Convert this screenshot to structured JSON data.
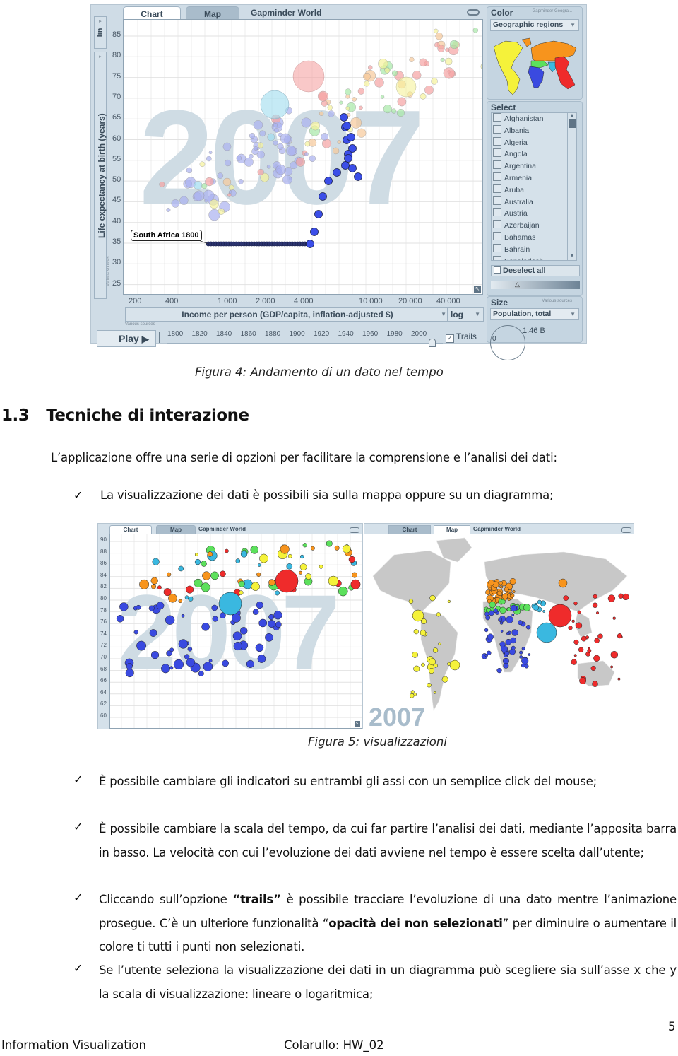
{
  "figure4": {
    "tabs": [
      {
        "label": "Chart",
        "active": true
      },
      {
        "label": "Map",
        "active": false
      }
    ],
    "title": "Gapminder World",
    "link_icon": "link-icon",
    "y_scale_label": "lin",
    "y_axis_label": "Life expectancy at birth (years)",
    "y_ticks": [
      "85",
      "80",
      "75",
      "70",
      "65",
      "60",
      "55",
      "50",
      "45",
      "40",
      "35",
      "30",
      "25"
    ],
    "x_ticks": [
      "200",
      "400",
      "1 000",
      "2 000",
      "4 000",
      "10 000",
      "20 000",
      "40 000"
    ],
    "x_axis_label": "Income per person (GDP/capita, inflation-adjusted $)",
    "x_scale": "log",
    "sources_label": "Various sources",
    "background_year": "2007",
    "tooltip": "South Africa 1800",
    "play_label": "Play",
    "timeline_years": [
      "1800",
      "1820",
      "1840",
      "1860",
      "1880",
      "1900",
      "1920",
      "1940",
      "1960",
      "1980",
      "2000"
    ],
    "trails_label": "Trails",
    "trails_checked": true,
    "color_panel": {
      "title": "Color",
      "source": "Gapminder Geogra...",
      "selected": "Geographic regions",
      "region_colors": {
        "americas": "#f5f23a",
        "europe_central_asia": "#f7941d",
        "middle_east_north_africa": "#5ce05c",
        "sub_saharan_africa": "#3a4ae0",
        "south_asia": "#3ab8e0",
        "east_asia_pacific": "#ef2b2b"
      }
    },
    "select_panel": {
      "title": "Select",
      "countries": [
        "Afghanistan",
        "Albania",
        "Algeria",
        "Angola",
        "Argentina",
        "Armenia",
        "Aruba",
        "Australia",
        "Austria",
        "Azerbaijan",
        "Bahamas",
        "Bahrain",
        "Bangladesh"
      ],
      "deselect_label": "Deselect all"
    },
    "size_panel": {
      "title": "Size",
      "source": "Various sources",
      "selected": "Population, total",
      "max_label": "1.46 B",
      "min_label": "0"
    },
    "caption": "Figura 4: Andamento di un dato nel tempo"
  },
  "section": {
    "number": "1.3",
    "title": "Tecniche di interazione",
    "intro": "L’applicazione offre una serie di opzioni per facilitare la comprensione e l’analisi dei dati:",
    "bullet1": "La visualizzazione dei dati è possibili sia sulla mappa oppure su un diagramma;"
  },
  "figure5": {
    "chart": {
      "tabs": [
        "Chart",
        "Map"
      ],
      "title": "Gapminder World",
      "y_ticks": [
        "90",
        "88",
        "86",
        "84",
        "82",
        "80",
        "78",
        "76",
        "74",
        "72",
        "70",
        "68",
        "66",
        "64",
        "62",
        "60"
      ],
      "background_year": "2007"
    },
    "map": {
      "tabs": [
        "Chart",
        "Map"
      ],
      "title": "Gapminder World",
      "year_label": "2007"
    },
    "caption": "Figura 5: visualizzazioni"
  },
  "bullets": [
    {
      "parts": [
        {
          "t": "È possibile cambiare gli indicatori su entrambi gli assi con un semplice click del mouse;"
        }
      ]
    },
    {
      "parts": [
        {
          "t": "È possibile cambiare la scala del tempo, da cui far partire l’analisi dei dati, mediante l’apposita barra in basso. La velocità con cui l’evoluzione dei dati avviene nel tempo è essere scelta dall’utente;"
        }
      ]
    },
    {
      "parts": [
        {
          "t": "Cliccando sull’opzione "
        },
        {
          "t": "“trails”",
          "bold": true
        },
        {
          "t": " è possibile tracciare l’evoluzione di una dato mentre l’animazione prosegue. C’è un ulteriore funzionalità “"
        },
        {
          "t": "opacità dei non selezionati",
          "bold": true
        },
        {
          "t": "” per diminuire o aumentare il colore ti tutti i punti non selezionati."
        }
      ]
    },
    {
      "parts": [
        {
          "t": "Se l’utente seleziona la visualizzazione dei dati in un diagramma può scegliere sia sull’asse x che y la scala di visualizzazione: lineare o logaritmica;"
        }
      ]
    }
  ],
  "bullet_glyph": "✓",
  "footer": {
    "page_number": "5",
    "left": "Information Visualization",
    "center": "Colarullo: HW_02"
  }
}
